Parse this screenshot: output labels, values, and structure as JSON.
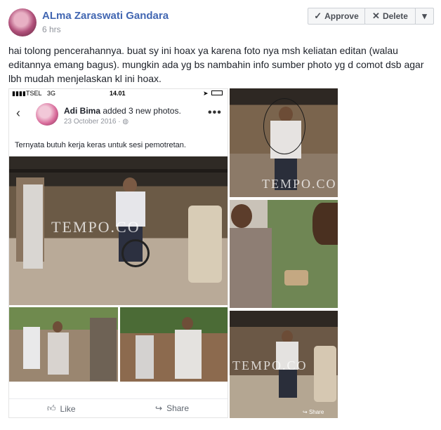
{
  "post": {
    "author": "ALma Zaraswati Gandara",
    "time": "6 hrs",
    "text": "hai tolong pencerahannya. buat sy ini hoax ya karena foto nya msh keliatan editan (walau editannya emang bagus). mungkin ada yg bs nambahin info sumber photo yg d comot dsb agar lbh mudah menjelaskan kl ini hoax."
  },
  "actions": {
    "approve_label": "Approve",
    "delete_label": "Delete",
    "approve_icon": "check-icon",
    "delete_icon": "close-icon",
    "more_icon": "chevron-down-icon"
  },
  "phone": {
    "status": {
      "carrier": "TSEL",
      "network": "3G",
      "time": "14.01"
    },
    "author": "Adi Bima",
    "action_text": " added 3 new photos.",
    "date": "23 October 2016 · ",
    "caption": "Ternyata butuh kerja keras untuk sesi pemotretan.",
    "like_label": "Like",
    "share_label": "Share"
  },
  "watermark": "TEMPO.CO",
  "image_share_label": "Share",
  "colors": {
    "link": "#4267b2",
    "muted": "#90949c",
    "button_bg": "#f5f6f7"
  }
}
